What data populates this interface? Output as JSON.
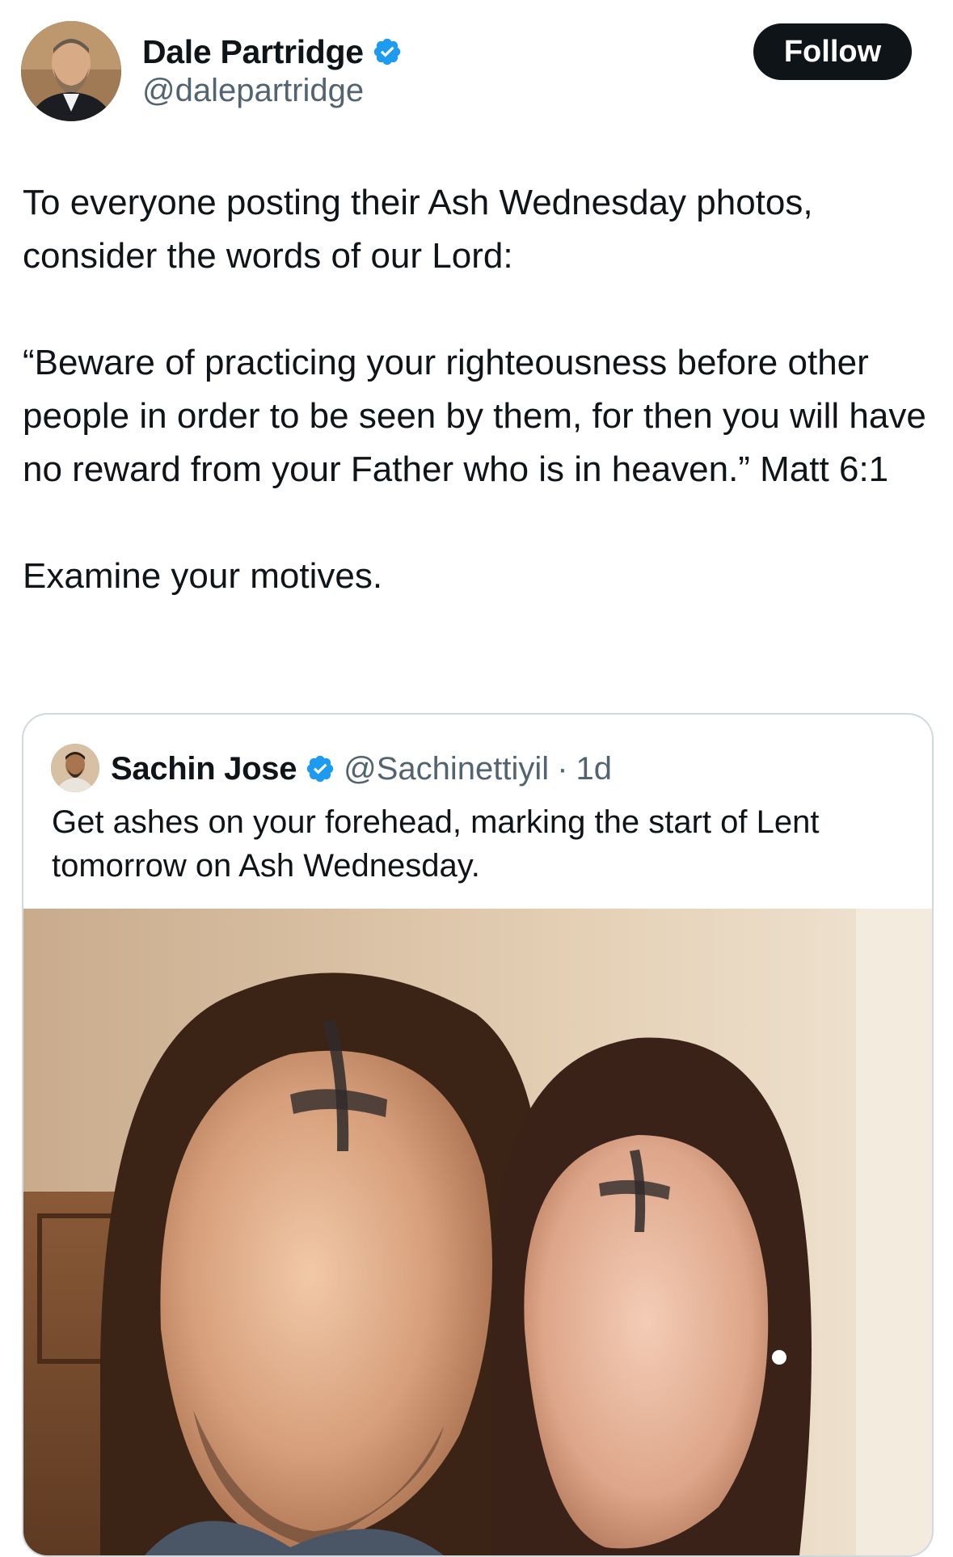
{
  "author": {
    "name": "Dale Partridge",
    "handle": "@dalepartridge",
    "verified": true,
    "avatar_icon": "profile-photo"
  },
  "follow_button": {
    "label": "Follow"
  },
  "tweet": {
    "paragraphs": [
      "To everyone posting their Ash Wednesday photos, consider the words of our Lord:",
      "“Beware of practicing your righteousness before other people in order to be seen by them, for then you will have no reward from your Father who is in heaven.” Matt 6:1",
      "Examine your motives."
    ]
  },
  "quoted_tweet": {
    "name": "Sachin Jose",
    "handle": "@Sachinettiyil",
    "separator": "·",
    "time": "1d",
    "verified": true,
    "text": "Get ashes on your forehead, marking the start of Lent tomorrow on Ash Wednesday.",
    "media_icon": "photo-two-people-with-ash-crosses"
  },
  "colors": {
    "verified_badge": "#1d9bf0",
    "text_primary": "#0f1419",
    "text_secondary": "#536471",
    "border": "#cfd9de",
    "follow_bg": "#0f1419"
  }
}
